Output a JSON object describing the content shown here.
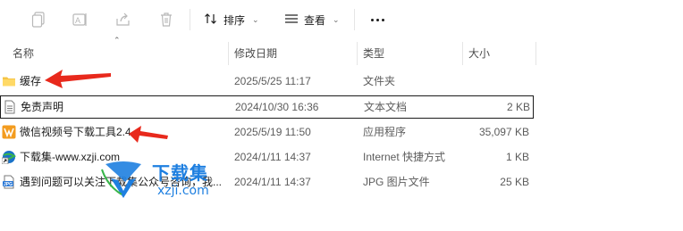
{
  "toolbar": {
    "sort_label": "排序",
    "view_label": "查看",
    "icons": [
      "copy-icon",
      "rename-icon",
      "share-icon",
      "delete-icon",
      "sort-icon",
      "view-icon",
      "more-icon"
    ]
  },
  "columns": {
    "name": "名称",
    "date": "修改日期",
    "type": "类型",
    "size": "大小"
  },
  "files": [
    {
      "name": "缓存",
      "date": "2025/5/25 11:17",
      "type": "文件夹",
      "size": ""
    },
    {
      "name": "免责声明",
      "date": "2024/10/30 16:36",
      "type": "文本文档",
      "size": "2 KB"
    },
    {
      "name": "微信视频号下载工具2.4",
      "date": "2025/5/19 11:50",
      "type": "应用程序",
      "size": "35,097 KB"
    },
    {
      "name": "下载集-www.xzji.com",
      "date": "2024/1/11 14:37",
      "type": "Internet 快捷方式",
      "size": "1 KB"
    },
    {
      "name": "遇到问题可以关注下载集公众号咨询，我...",
      "date": "2024/1/11 14:37",
      "type": "JPG 图片文件",
      "size": "25 KB"
    }
  ],
  "watermark": {
    "text": "下载集",
    "url": "xzji.com"
  },
  "colors": {
    "accent": "#1e7fe0",
    "arrow": "#e8291c",
    "folder": "#f6c445"
  }
}
